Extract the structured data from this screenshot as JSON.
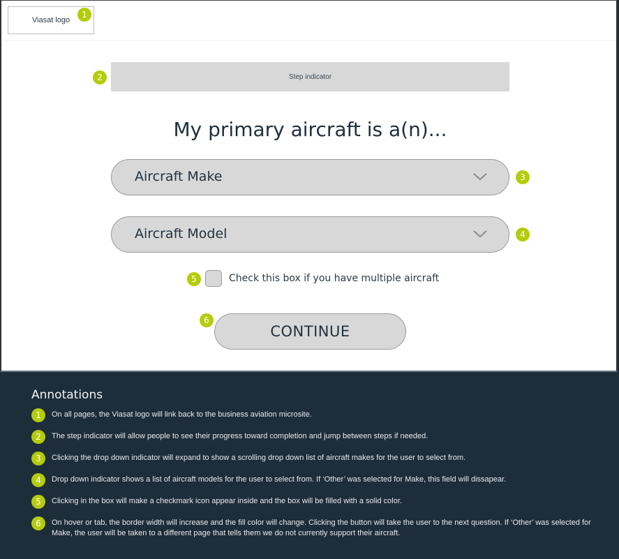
{
  "header": {
    "logo_label": "Viasat logo",
    "logo_badge": "1"
  },
  "step_indicator": {
    "label": "Step indicator",
    "badge": "2"
  },
  "page_title": "My primary aircraft is a(n)...",
  "form": {
    "make_dropdown": {
      "placeholder": "Aircraft Make",
      "badge": "3",
      "icon": "chevron-down-icon"
    },
    "model_dropdown": {
      "placeholder": "Aircraft Model",
      "badge": "4",
      "icon": "chevron-down-icon"
    },
    "multiple_checkbox": {
      "label": "Check this box if you have multiple aircraft",
      "checked": false,
      "badge": "5"
    },
    "continue_button": {
      "label": "CONTINUE",
      "badge": "6"
    }
  },
  "annotations": {
    "title": "Annotations",
    "items": [
      {
        "num": "1",
        "text": "On all pages, the Viasat logo will link back to the business aviation microsite."
      },
      {
        "num": "2",
        "text": "The step indicator will allow people to see their progress toward completion and jump between steps if needed."
      },
      {
        "num": "3",
        "text": "Clicking the drop down indicator will expand to show a scrolling drop down list of aircraft makes for the user to select from."
      },
      {
        "num": "4",
        "text": "Drop down indicator shows a list of aircraft models for the user to select from. If ‘Other’ was selected for Make, this field will dissapear."
      },
      {
        "num": "5",
        "text": "Clicking in the box will make a checkmark icon appear inside and the box  will be filled with a solid color."
      },
      {
        "num": "6",
        "text": "On hover or tab, the border width will increase and the fill color will change. Clicking the button will take the user to the next question.  If ‘Other’ was selected for Make, the user will be taken to a different page that tells them we do not currently support their aircraft."
      }
    ]
  },
  "colors": {
    "annotation_badge": "#b4cc0a",
    "annotation_panel_bg": "#1e2d3a",
    "control_fill": "#d8d8d8",
    "text_dark": "#1f2f3b"
  }
}
